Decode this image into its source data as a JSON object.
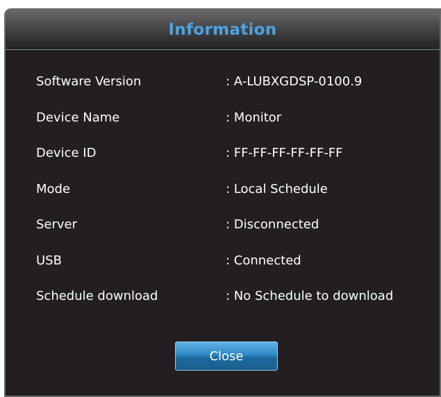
{
  "dialog": {
    "title": "Information",
    "rows": [
      {
        "label": "Software Version",
        "value": ": A-LUBXGDSP-0100.9"
      },
      {
        "label": "Device Name",
        "value": ": Monitor"
      },
      {
        "label": "Device ID",
        "value": ": FF-FF-FF-FF-FF-FF"
      },
      {
        "label": "Mode",
        "value": ": Local Schedule"
      },
      {
        "label": "Server",
        "value": ": Disconnected"
      },
      {
        "label": "USB",
        "value": ": Connected"
      },
      {
        "label": "Schedule download",
        "value": ": No Schedule to download"
      }
    ],
    "close_label": "Close"
  },
  "colors": {
    "title": "#4fa3e0",
    "background": "#231f20",
    "button": "#2f8ac4",
    "text": "#ffffff"
  }
}
